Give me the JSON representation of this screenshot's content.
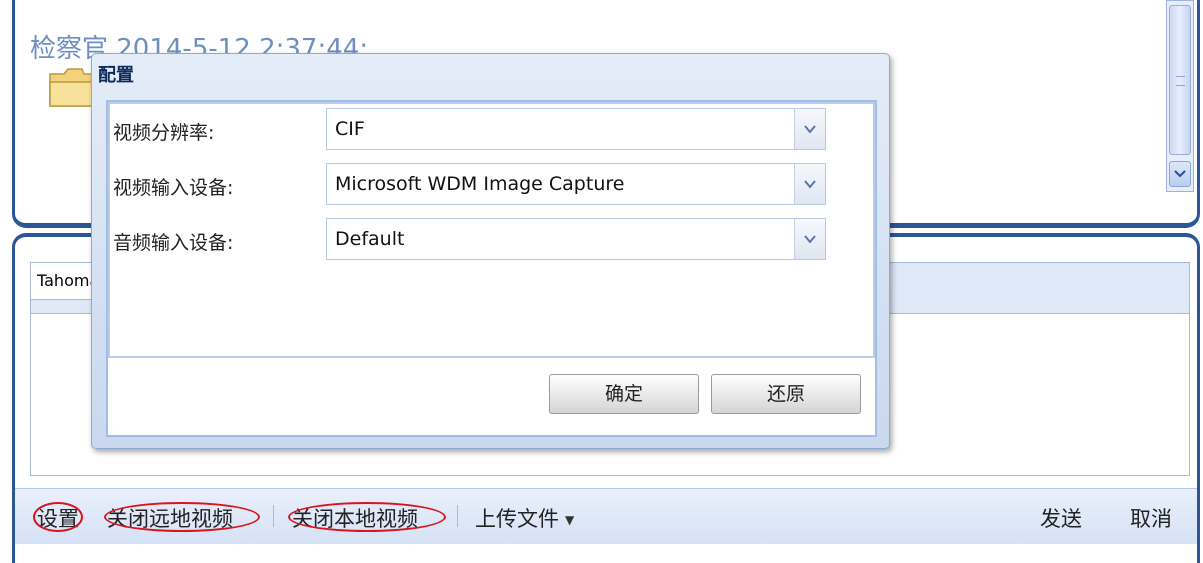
{
  "chat": {
    "header": "检察官  2014-5-12 2:37:44:"
  },
  "input": {
    "font_name": "Tahoma"
  },
  "toolbar": {
    "settings": "设置",
    "close_remote_video": "关闭远地视频",
    "close_local_video": "关闭本地视频",
    "upload_file": "上传文件",
    "send": "发送",
    "cancel": "取消"
  },
  "dialog": {
    "title": "配置",
    "fields": [
      {
        "label": "视频分辨率:",
        "value": "CIF"
      },
      {
        "label": "视频输入设备:",
        "value": "Microsoft WDM Image Capture"
      },
      {
        "label": "音频输入设备:",
        "value": "Default"
      }
    ],
    "ok_label": "确定",
    "reset_label": "还原"
  },
  "colors": {
    "frame": "#2b5797",
    "highlight_ellipse": "#d8141c",
    "header_text": "#6f8fc0"
  },
  "icons": [
    "folder-icon",
    "chevron-down-icon",
    "dropdown-arrow-icon",
    "caret-down-icon"
  ]
}
